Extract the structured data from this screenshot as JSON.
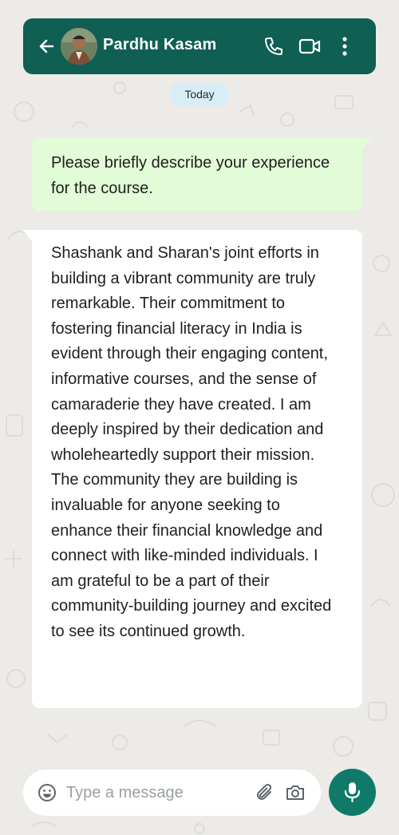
{
  "theme": {
    "header_bg": "#0f5f53",
    "outgoing_bubble": "#e1fcd6",
    "incoming_bubble": "#ffffff",
    "chat_bg": "#ecebe8",
    "mic_button": "#0f7a68",
    "date_pill": "#d8eef7"
  },
  "header": {
    "back_icon": "arrow-left-icon",
    "contact_name": "Pardhu Kasam",
    "icons": [
      "phone-icon",
      "video-camera-icon",
      "more-vertical-icon"
    ]
  },
  "chat": {
    "date_label": "Today",
    "messages": [
      {
        "direction": "outgoing",
        "text": "Please briefly describe your experience for the course."
      },
      {
        "direction": "incoming",
        "text": "Shashank and Sharan's joint efforts in building a vibrant community are truly remarkable. Their commitment to fostering financial literacy in India is evident through their engaging content, informative courses, and the sense of camaraderie they have created. I am deeply inspired by their dedication and wholeheartedly support their mission. The community they are building is invaluable for anyone seeking to enhance their financial knowledge and connect with like-minded individuals. I am grateful to be a part of their community-building journey and excited to see its continued growth."
      }
    ]
  },
  "composer": {
    "emoji_icon": "smiley-icon",
    "placeholder": "Type a message",
    "value": "",
    "attach_icon": "paperclip-icon",
    "camera_icon": "camera-icon",
    "mic_icon": "microphone-icon"
  }
}
